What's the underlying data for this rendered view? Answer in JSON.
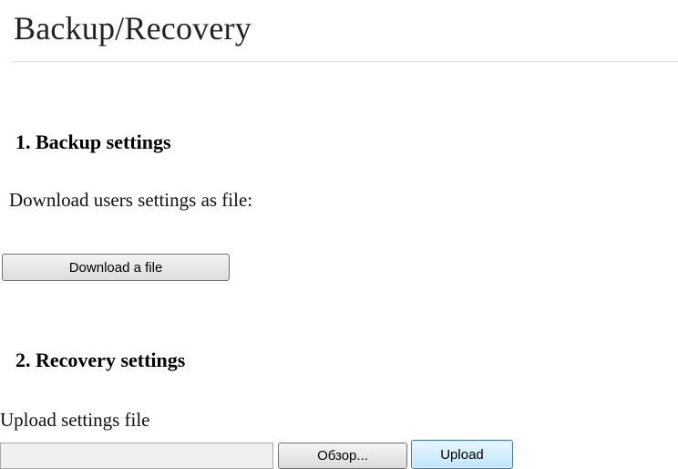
{
  "page": {
    "title": "Backup/Recovery"
  },
  "backup": {
    "heading": "1. Backup settings",
    "label": "Download users settings as file:",
    "download_button": "Download a file"
  },
  "recovery": {
    "heading": "2. Recovery settings",
    "label": "Upload settings file",
    "file_input_value": "",
    "browse_button": "Обзор...",
    "upload_button": "Upload"
  },
  "colors": {
    "upload_button_border": "#3c7fb1",
    "upload_button_fill": "#bee6fd",
    "divider": "#e3e3e3"
  }
}
